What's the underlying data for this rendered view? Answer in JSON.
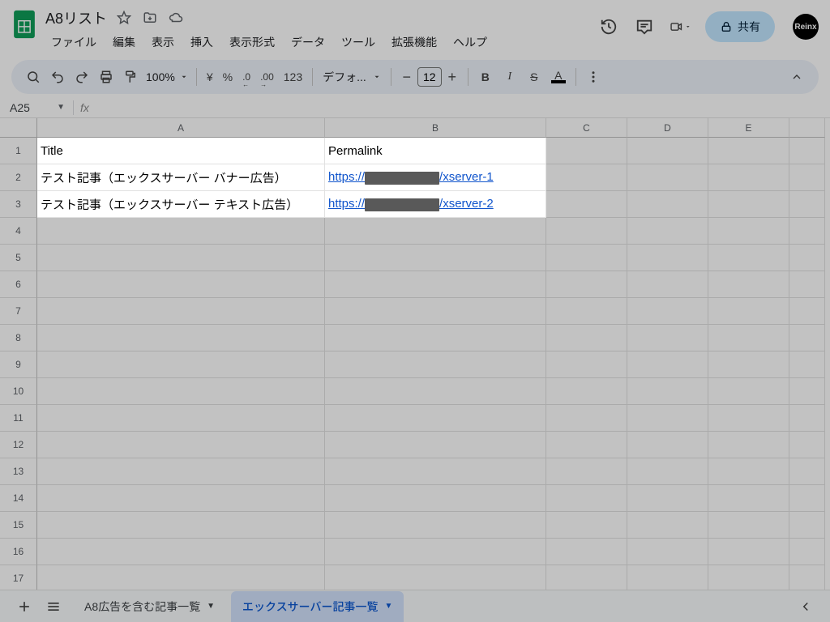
{
  "doc": {
    "title": "A8リスト"
  },
  "menus": [
    "ファイル",
    "編集",
    "表示",
    "挿入",
    "表示形式",
    "データ",
    "ツール",
    "拡張機能",
    "ヘルプ"
  ],
  "share": {
    "label": "共有"
  },
  "avatar": {
    "text": "Reinx"
  },
  "toolbar": {
    "zoom": "100%",
    "currency": "¥",
    "percent": "%",
    "dec_dec": ".0",
    "dec_inc": ".00",
    "numfmt": "123",
    "font": "デフォ...",
    "size": "12"
  },
  "namebox": "A25",
  "columns": [
    "A",
    "B",
    "C",
    "D",
    "E"
  ],
  "rows": [
    {
      "n": "1",
      "a": "Title",
      "b_type": "text",
      "b": "Permalink"
    },
    {
      "n": "2",
      "a": "テスト記事（エックスサーバー バナー広告）",
      "b_type": "link",
      "b_pre": "https://",
      "b_post": "/xserver-1",
      "b_redact_w": 92
    },
    {
      "n": "3",
      "a": "テスト記事（エックスサーバー テキスト広告）",
      "b_type": "link",
      "b_pre": "https://",
      "b_post": "/xserver-2",
      "b_redact_w": 92
    },
    {
      "n": "4"
    },
    {
      "n": "5"
    },
    {
      "n": "6"
    },
    {
      "n": "7"
    },
    {
      "n": "8"
    },
    {
      "n": "9"
    },
    {
      "n": "10"
    },
    {
      "n": "11"
    },
    {
      "n": "12"
    },
    {
      "n": "13"
    },
    {
      "n": "14"
    },
    {
      "n": "15"
    },
    {
      "n": "16"
    },
    {
      "n": "17"
    }
  ],
  "tabs": {
    "inactive": "A8広告を含む記事一覧",
    "active": "エックスサーバー記事一覧"
  }
}
